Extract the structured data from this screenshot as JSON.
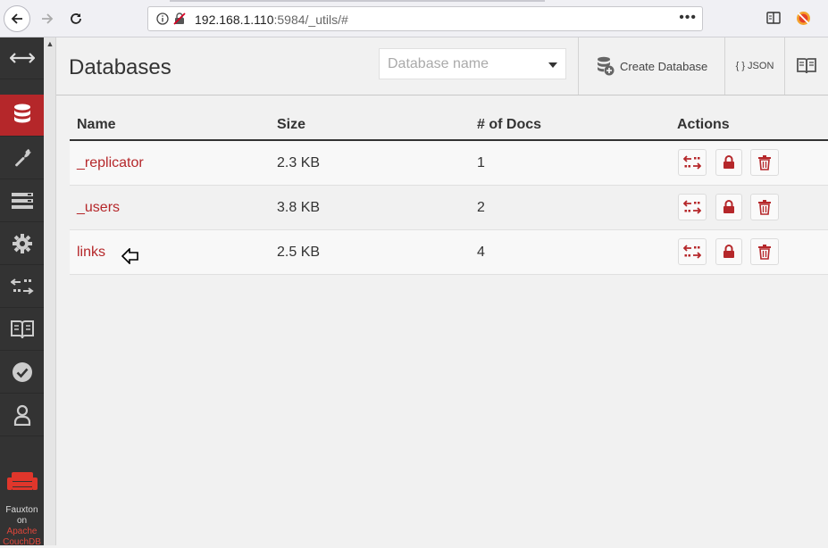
{
  "browser": {
    "url_host": "192.168.1.110",
    "url_rest": ":5984/_utils/#"
  },
  "sidebar": {
    "items": [
      {
        "name": "toggle",
        "icon": "double-arrow-icon"
      },
      {
        "name": "databases",
        "icon": "database-icon",
        "active": true
      },
      {
        "name": "setup",
        "icon": "wrench-icon"
      },
      {
        "name": "active-tasks",
        "icon": "tasks-icon"
      },
      {
        "name": "config",
        "icon": "gear-icon"
      },
      {
        "name": "replication",
        "icon": "replication-icon"
      },
      {
        "name": "documentation",
        "icon": "book-icon"
      },
      {
        "name": "verify",
        "icon": "check-icon"
      },
      {
        "name": "user",
        "icon": "user-icon"
      }
    ],
    "footer_line1": "Fauxton",
    "footer_line2": "on",
    "footer_line3": "Apache",
    "footer_line4": "CouchDB"
  },
  "header": {
    "title": "Databases",
    "search_placeholder": "Database name",
    "create_label": "Create Database",
    "json_label": "{ } JSON"
  },
  "table": {
    "columns": [
      "Name",
      "Size",
      "# of Docs",
      "Actions"
    ],
    "rows": [
      {
        "name": "_replicator",
        "size": "2.3 KB",
        "docs": "1"
      },
      {
        "name": "_users",
        "size": "3.8 KB",
        "docs": "2"
      },
      {
        "name": "links",
        "size": "2.5 KB",
        "docs": "4"
      }
    ]
  },
  "colors": {
    "accent": "#b5272a",
    "sidebar_bg": "#333333"
  }
}
